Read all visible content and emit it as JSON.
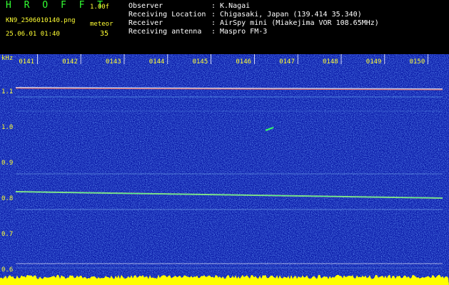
{
  "header": {
    "title": "H R O F F T",
    "version": "1.00f",
    "filename": "KN9_2506010140.png",
    "meteor_label": "meteor",
    "datetime": "25.06.01 01:40",
    "meteor_count": "35",
    "metadata": [
      {
        "key": "Observer",
        "value": ": K.Nagai"
      },
      {
        "key": "Receiving Location",
        "value": ": Chigasaki, Japan (139.414 35.340)"
      },
      {
        "key": "Receiver",
        "value": ": AirSpy mini (Miakejima VOR 108.65MHz)"
      },
      {
        "key": "Receiving antenna",
        "value": ": Maspro FM-3"
      }
    ]
  },
  "spectrogram": {
    "y_unit": "kHz",
    "y_ticks": [
      "1.1",
      "1.0",
      "0.9",
      "0.8",
      "0.7",
      "0.6"
    ],
    "time_ticks": [
      "0141",
      "0142",
      "0143",
      "0144",
      "0145",
      "0146",
      "0147",
      "0148",
      "0149",
      "0150"
    ],
    "colors": {
      "background": "#0a1aa8",
      "text": "#ffff33",
      "grid": "#ffffff",
      "noise_floor": "#ffff00"
    }
  }
}
